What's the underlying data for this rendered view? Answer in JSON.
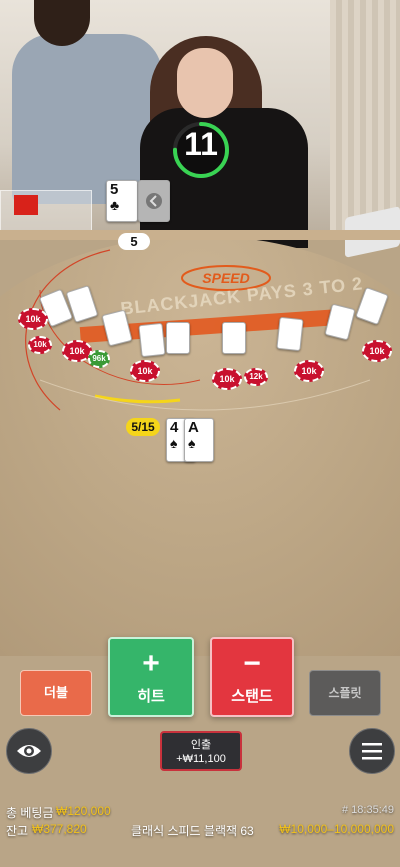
{
  "timer": {
    "seconds": "11",
    "progress": 0.75,
    "ring_color": "#39d353"
  },
  "dealer": {
    "cards": [
      {
        "rank": "5",
        "suit": "♣"
      }
    ],
    "hidden_card": true,
    "count": "5"
  },
  "table": {
    "logo": "SPEED",
    "payout_text": "BLACKJACK PAYS 3 TO 2"
  },
  "player": {
    "count": "5/15",
    "cards": [
      {
        "rank": "4",
        "suit": "♠"
      },
      {
        "rank": "A",
        "suit": "♠"
      }
    ]
  },
  "seat_chips": [
    "10k",
    "10k",
    "10k",
    "10k",
    "10k",
    "10k",
    "10k"
  ],
  "side_chips": [
    "96k",
    "12k"
  ],
  "actions": {
    "double": "더블",
    "hit_symbol": "+",
    "hit": "히트",
    "stand_symbol": "−",
    "stand": "스탠드",
    "split": "스플릿"
  },
  "cashout": {
    "label": "인출",
    "amount": "+₩11,100"
  },
  "footer": {
    "total_bet_label": "총 베팅금",
    "total_bet_value": "₩120,000",
    "balance_label": "잔고",
    "balance_value": "₩377,820",
    "game_id": "# 18:35:49",
    "table_name": "클래식 스피드 블랙잭 63",
    "limits": "₩10,000–10,000,000"
  },
  "colors": {
    "hit": "#35b56a",
    "stand": "#e3363f",
    "double": "#e96a4a",
    "split": "#5c5b5a",
    "accent_yellow": "#f2c21c"
  },
  "icons": {
    "eye": "eye-icon",
    "menu": "menu-icon"
  }
}
